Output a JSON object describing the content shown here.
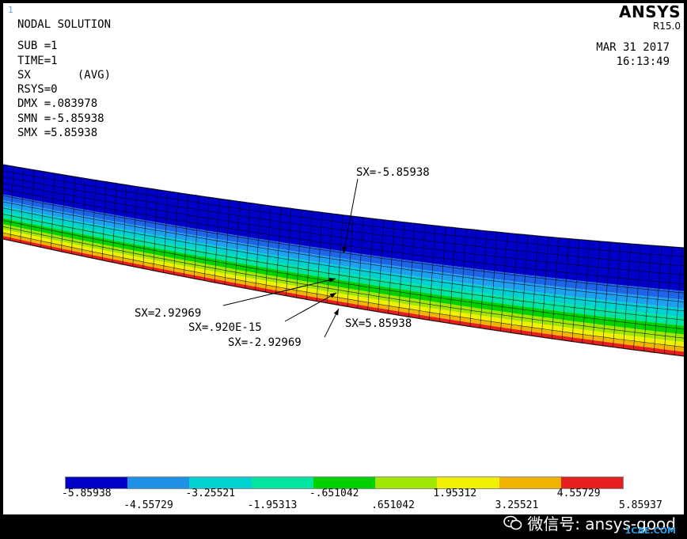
{
  "window_number": "1",
  "brand": {
    "name": "ANSYS",
    "version": "R15.0"
  },
  "datetime": {
    "date": "MAR 31 2017",
    "time": "16:13:49"
  },
  "info": {
    "title": "NODAL SOLUTION",
    "lines": [
      "SUB =1",
      "TIME=1",
      "SX       (AVG)",
      "RSYS=0",
      "DMX =.083978",
      "SMN =-5.85938",
      "SMX =5.85938"
    ]
  },
  "annotations": {
    "top": "SX=-5.85938",
    "a1": "SX=2.92969",
    "a2": "SX=.920E-15",
    "a3": "SX=-2.92969",
    "a4": "SX=5.85938"
  },
  "legend": {
    "colors": [
      "#0000c8",
      "#1e90e6",
      "#00d2d2",
      "#00e6a0",
      "#00d200",
      "#a0e600",
      "#f0f000",
      "#f0b400",
      "#e61e1e"
    ],
    "labels_top": [
      "-5.85938",
      "-3.25521",
      "-.651042",
      "1.95312",
      "4.55729"
    ],
    "labels_bottom": [
      "-4.55729",
      "-1.95313",
      ".651042",
      "3.25521",
      "5.85937"
    ]
  },
  "watermark": {
    "wechat": "微信号: ansys-good",
    "site": "1CAE.COM"
  }
}
